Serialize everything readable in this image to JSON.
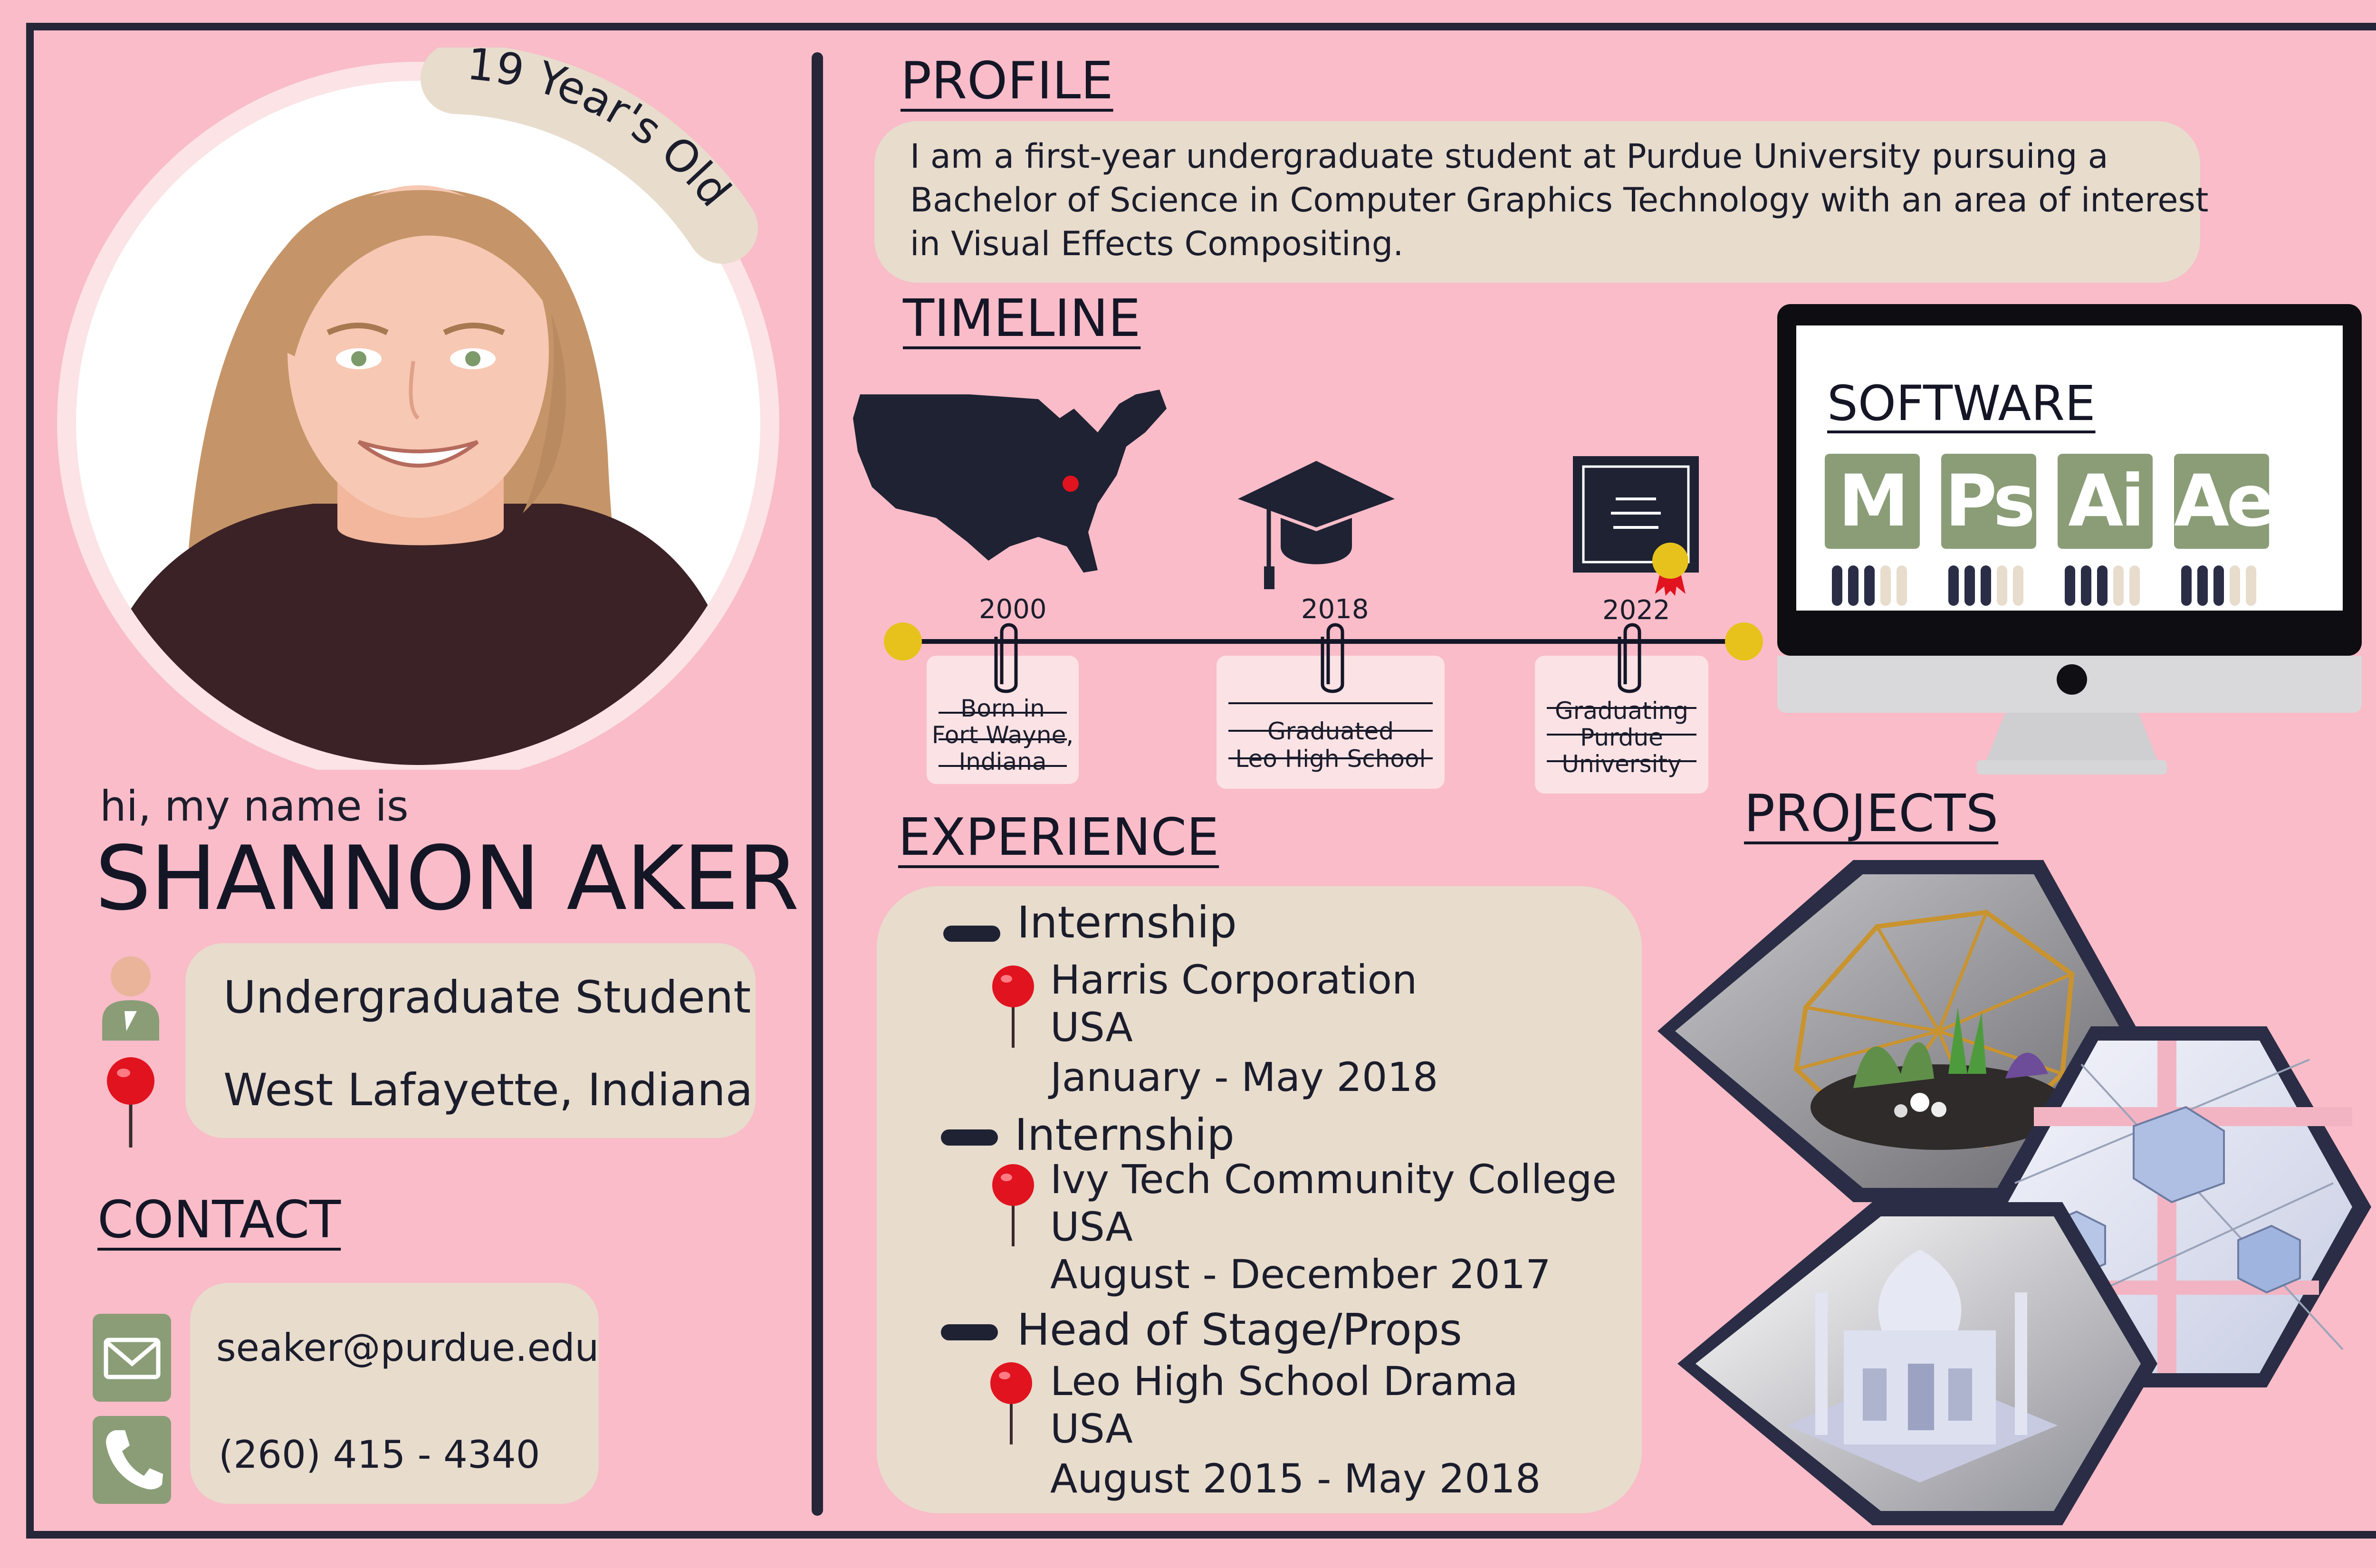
{
  "header": {
    "age_label": "19 Year's Old",
    "greeting": "hi, my name is",
    "name": "SHANNON AKER"
  },
  "info": {
    "role": "Undergraduate Student",
    "location": "West Lafayette, Indiana"
  },
  "contact": {
    "title": "CONTACT",
    "email": "seaker@purdue.edu",
    "phone": "(260) 415 - 4340"
  },
  "profile": {
    "title": "PROFILE",
    "lines": [
      "I am a first-year undergraduate student at Purdue University pursuing a",
      "Bachelor of Science in Computer Graphics Technology with an area of interest",
      "in Visual Effects Compositing."
    ]
  },
  "timeline": {
    "title": "TIMELINE",
    "events": [
      {
        "year": "2000",
        "lines": [
          "Born in",
          "Fort Wayne,",
          "Indiana"
        ]
      },
      {
        "year": "2018",
        "lines": [
          "Graduated",
          "Leo High School"
        ]
      },
      {
        "year": "2022",
        "lines": [
          "Graduating",
          "Purdue",
          "University"
        ]
      }
    ]
  },
  "software": {
    "title": "SOFTWARE",
    "apps": [
      {
        "label": "M",
        "level": 3,
        "max": 5
      },
      {
        "label": "Ps",
        "level": 3,
        "max": 5
      },
      {
        "label": "Ai",
        "level": 3,
        "max": 5
      },
      {
        "label": "Ae",
        "level": 3,
        "max": 5
      }
    ]
  },
  "experience": {
    "title": "EXPERIENCE",
    "items": [
      {
        "role": "Internship",
        "org": "Harris Corporation",
        "country": "USA",
        "dates": "January - May 2018"
      },
      {
        "role": "Internship",
        "org": "Ivy Tech Community College",
        "country": "USA",
        "dates": "August - December 2017"
      },
      {
        "role": "Head of Stage/Props",
        "org": "Leo High School Drama",
        "country": "USA",
        "dates": "August 2015 - May 2018"
      }
    ]
  },
  "projects": {
    "title": "PROJECTS"
  },
  "colors": {
    "background": "#f9bcc8",
    "navy": "#252638",
    "beige": "#e8dccd",
    "sage": "#8a9d77",
    "pin_red": "#e0131f",
    "gold": "#e8c21c"
  }
}
